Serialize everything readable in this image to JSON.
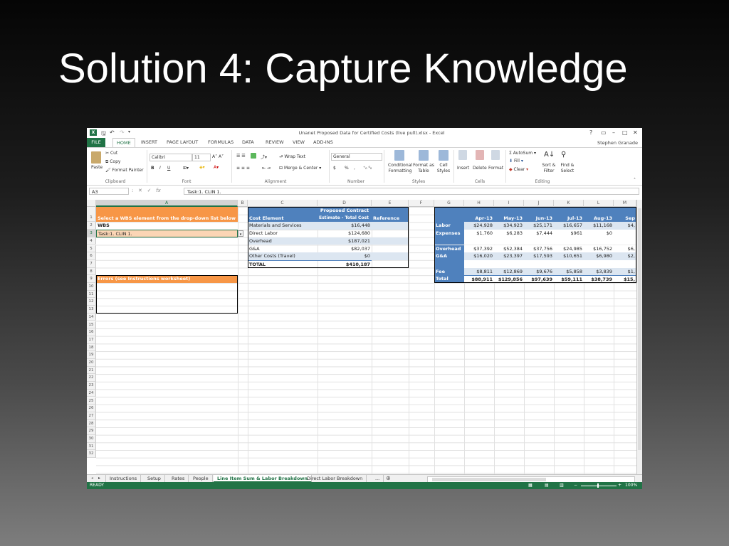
{
  "slide": {
    "title": "Solution 4: Capture Knowledge"
  },
  "window": {
    "title": "Unanet Proposed Data for Certified Costs (live pull).xlsx - Excel",
    "user": "Stephen Granade",
    "controls": [
      "?",
      "▭",
      "–",
      "□",
      "✕"
    ]
  },
  "ribbon_tabs": [
    "FILE",
    "HOME",
    "INSERT",
    "PAGE LAYOUT",
    "FORMULAS",
    "DATA",
    "REVIEW",
    "VIEW",
    "ADD-INS"
  ],
  "ribbon": {
    "clipboard": {
      "cut": "Cut",
      "copy": "Copy",
      "paste": "Paste",
      "format_painter": "Format Painter",
      "label": "Clipboard"
    },
    "font": {
      "name": "Calibri",
      "size": "11",
      "label": "Font",
      "bold": "B",
      "italic": "I",
      "underline": "U"
    },
    "alignment": {
      "wrap": "Wrap Text",
      "merge": "Merge & Center",
      "label": "Alignment"
    },
    "number": {
      "format": "General",
      "currency": "$",
      "percent": "%",
      "comma": ",",
      "label": "Number"
    },
    "styles": {
      "conditional": "Conditional Formatting",
      "format_table": "Format as Table",
      "cell_styles": "Cell Styles",
      "label": "Styles"
    },
    "cells": {
      "insert": "Insert",
      "delete": "Delete",
      "format": "Format",
      "label": "Cells"
    },
    "editing": {
      "autosum": "AutoSum",
      "fill": "Fill",
      "clear": "Clear",
      "sort": "Sort & Filter",
      "find": "Find & Select",
      "label": "Editing"
    }
  },
  "formula_bar": {
    "name_box": "A3",
    "fx": "fx",
    "content": "Task:1. CLIN 1."
  },
  "columns": [
    "A",
    "B",
    "C",
    "D",
    "E",
    "F",
    "G",
    "H",
    "I",
    "J",
    "K",
    "L",
    "M"
  ],
  "rows": [
    "1",
    "2",
    "3",
    "4",
    "5",
    "6",
    "7",
    "8",
    "9",
    "10",
    "11",
    "12",
    "13",
    "14",
    "15",
    "16",
    "17",
    "18",
    "19",
    "20",
    "21",
    "22",
    "23",
    "24",
    "25",
    "26",
    "27",
    "28",
    "29",
    "30",
    "31",
    "32"
  ],
  "cellsA": {
    "a1": "Select a WBS element from the drop-down list below",
    "a2": "WBS",
    "a3": "Task:1. CLIN 1.",
    "a9": "Errors (see Instructions worksheet)"
  },
  "cost_table": {
    "header_top": "Proposed Contract",
    "headers": [
      "Cost Element",
      "Estimate - Total Cost",
      "Reference"
    ],
    "rows": [
      {
        "element": "Materials and Services",
        "cost": "$16,448"
      },
      {
        "element": "Direct Labor",
        "cost": "$124,680"
      },
      {
        "element": "Overhead",
        "cost": "$187,021"
      },
      {
        "element": "G&A",
        "cost": "$82,037"
      },
      {
        "element": "Other Costs (Travel)",
        "cost": "$0"
      },
      {
        "element": "TOTAL",
        "cost": "$410,187"
      }
    ]
  },
  "monthly_table": {
    "months": [
      "Apr-13",
      "May-13",
      "Jun-13",
      "Jul-13",
      "Aug-13",
      "Sep"
    ],
    "rows": [
      {
        "label": "Labor",
        "values": [
          "$24,928",
          "$34,923",
          "$25,171",
          "$16,657",
          "$11,168",
          "$4,"
        ]
      },
      {
        "label": "Expenses",
        "values": [
          "$1,760",
          "$6,283",
          "$7,444",
          "$961",
          "$0",
          ""
        ]
      },
      {
        "label": "",
        "values": [
          "",
          "",
          "",
          "",
          "",
          ""
        ]
      },
      {
        "label": "Overhead",
        "values": [
          "$37,392",
          "$52,384",
          "$37,756",
          "$24,985",
          "$16,752",
          "$6,"
        ]
      },
      {
        "label": "G&A",
        "values": [
          "$16,020",
          "$23,397",
          "$17,593",
          "$10,651",
          "$6,980",
          "$2,"
        ]
      },
      {
        "label": "",
        "values": [
          "",
          "",
          "",
          "",
          "",
          ""
        ]
      },
      {
        "label": "Fee",
        "values": [
          "$8,811",
          "$12,869",
          "$9,676",
          "$5,858",
          "$3,839",
          "$1,"
        ]
      },
      {
        "label": "Total",
        "values": [
          "$88,911",
          "$129,856",
          "$97,639",
          "$59,111",
          "$38,739",
          "$15,"
        ]
      }
    ]
  },
  "sheet_tabs": [
    "Instructions",
    "Setup",
    "Rates",
    "People",
    "Line Item Sum & Labor Breakdown",
    "Direct Labor Breakdown",
    "..."
  ],
  "status": {
    "ready": "READY",
    "zoom": "100%"
  }
}
